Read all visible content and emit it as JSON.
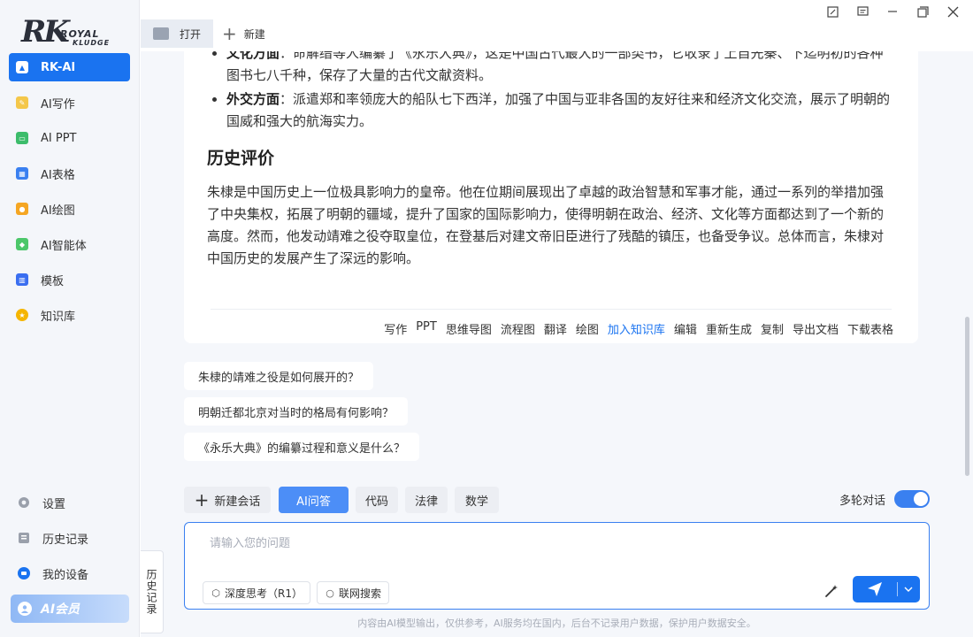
{
  "logo": {
    "mark": "RK",
    "line1": "ROYAL",
    "line2": "KLUDGE"
  },
  "sidebar": {
    "items": [
      {
        "label": "RK-AI",
        "icon": "rk-ai-icon",
        "color": "#1a73f0"
      },
      {
        "label": "AI写作",
        "icon": "write-icon",
        "color": "#f4c74a"
      },
      {
        "label": "AI PPT",
        "icon": "ppt-icon",
        "color": "#3cbc6b"
      },
      {
        "label": "AI表格",
        "icon": "table-icon",
        "color": "#3a80f0"
      },
      {
        "label": "AI绘图",
        "icon": "paint-icon",
        "color": "#f5a623"
      },
      {
        "label": "AI智能体",
        "icon": "agent-icon",
        "color": "#4cc76a"
      },
      {
        "label": "模板",
        "icon": "template-icon",
        "color": "#3a6ef0"
      },
      {
        "label": "知识库",
        "icon": "knowledge-icon",
        "color": "#f5b500"
      }
    ],
    "bottom": [
      {
        "label": "设置",
        "icon": "gear-icon"
      },
      {
        "label": "历史记录",
        "icon": "history-icon"
      },
      {
        "label": "我的设备",
        "icon": "device-icon"
      }
    ],
    "member_label": "AI会员"
  },
  "topbar": {
    "open_label": "打开",
    "new_label": "新建"
  },
  "answer": {
    "bullets": [
      {
        "head": "文化方面",
        "text": "：命解缙等人编纂了《永乐大典》，这是中国古代最大的一部类书，它收录了上自先秦、下迄明初的各种图书七八千种，保存了大量的古代文献资料。"
      },
      {
        "head": "外交方面",
        "text": "：派遣郑和率领庞大的船队七下西洋，加强了中国与亚非各国的友好往来和经济文化交流，展示了明朝的国威和强大的航海实力。"
      }
    ],
    "section_title": "历史评价",
    "paragraph": "朱棣是中国历史上一位极具影响力的皇帝。他在位期间展现出了卓越的政治智慧和军事才能，通过一系列的举措加强了中央集权，拓展了明朝的疆域，提升了国家的国际影响力，使得明朝在政治、经济、文化等方面都达到了一个新的高度。然而，他发动靖难之役夺取皇位，在登基后对建文帝旧臣进行了残酷的镇压，也备受争议。总体而言，朱棣对中国历史的发展产生了深远的影响。",
    "actions": [
      "写作",
      "PPT",
      "思维导图",
      "流程图",
      "翻译",
      "绘图",
      "加入知识库",
      "编辑",
      "重新生成",
      "复制",
      "导出文档",
      "下载表格"
    ],
    "highlight_action": "加入知识库"
  },
  "suggestions": [
    "朱棣的靖难之役是如何展开的？",
    "明朝迁都北京对当时的格局有何影响？",
    "《永乐大典》的编纂过程和意义是什么？"
  ],
  "toolbar": {
    "new_chat": "新建会话",
    "modes": [
      "AI问答",
      "代码",
      "法律",
      "数学"
    ],
    "active_mode": "AI问答",
    "multi_turn_label": "多轮对话",
    "multi_turn_on": true
  },
  "input": {
    "placeholder": "请输入您的问题",
    "deep_think": "深度思考（R1）",
    "web_search": "联网搜索"
  },
  "footer_note": "内容由AI模型输出，仅供参考，AI服务均在国内，后台不记录用户数据，保护用户数据安全。",
  "history_tab": "历史记录",
  "colors": {
    "accent": "#1a73f0",
    "link": "#1a73f0",
    "member_gradient": "#8fb8f5"
  }
}
